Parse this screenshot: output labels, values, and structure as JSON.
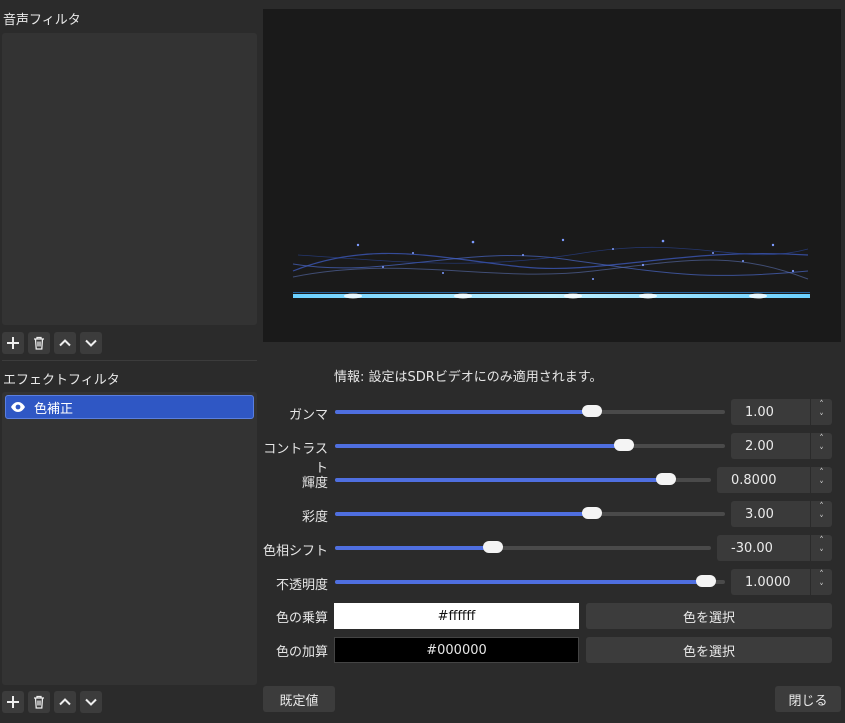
{
  "audio_filters": {
    "title": "音声フィルタ"
  },
  "effect_filters": {
    "title": "エフェクトフィルタ",
    "items": [
      {
        "label": "色補正",
        "visible": true
      }
    ]
  },
  "list_toolbar": {
    "add_icon": "plus-icon",
    "remove_icon": "trash-icon",
    "up_icon": "chevron-up-icon",
    "down_icon": "chevron-down-icon"
  },
  "info": {
    "text": "情報: 設定はSDRビデオにのみ適用されます。"
  },
  "settings": [
    {
      "label": "ガンマ",
      "value": "1.00",
      "level": 0.66
    },
    {
      "label": "コントラスト",
      "value": "2.00",
      "level": 0.74
    },
    {
      "label": "輝度",
      "value": "0.8000",
      "level": 0.88
    },
    {
      "label": "彩度",
      "value": "3.00",
      "level": 0.66
    },
    {
      "label": "色相シフト",
      "value": "-30.00",
      "level": 0.42
    },
    {
      "label": "不透明度",
      "value": "1.0000",
      "level": 0.95
    }
  ],
  "colors": [
    {
      "label": "色の乗算",
      "value": "#ffffff",
      "button": "色を選択"
    },
    {
      "label": "色の加算",
      "value": "#000000",
      "button": "色を選択"
    }
  ],
  "footer": {
    "defaults_label": "既定値",
    "close_label": "閉じる"
  },
  "accent_color": "#2f57c4"
}
